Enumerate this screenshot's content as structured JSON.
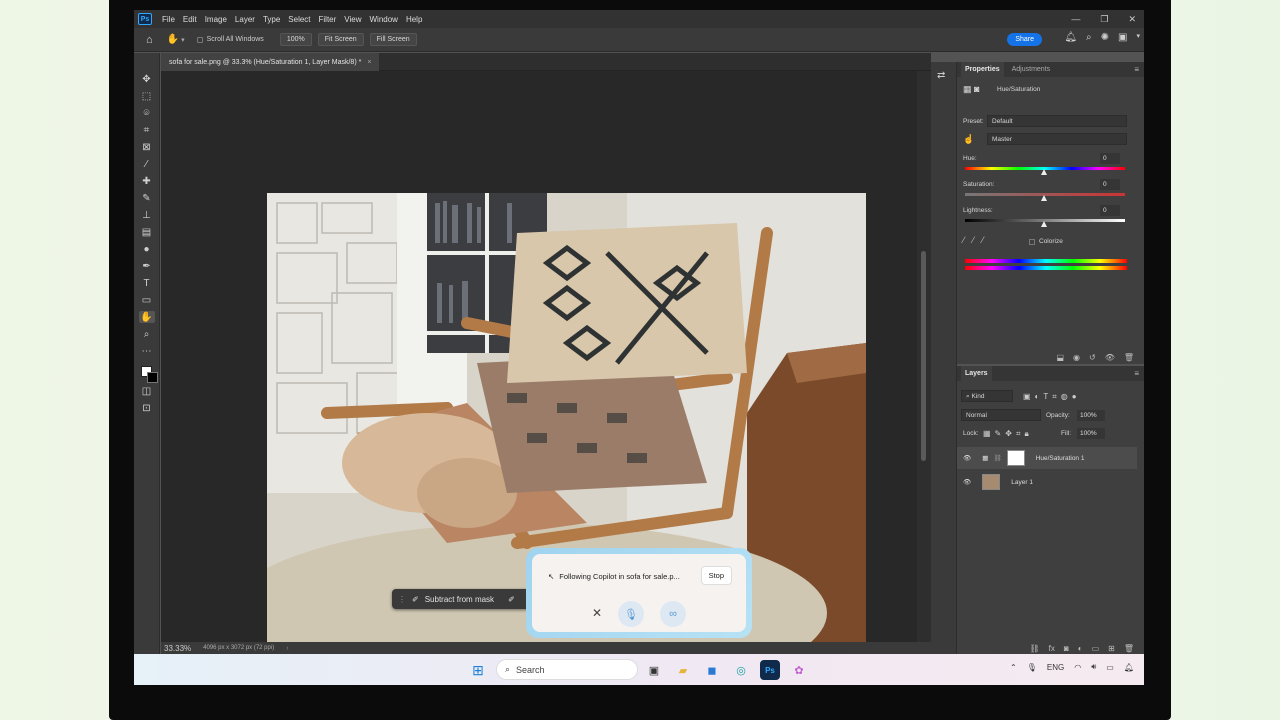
{
  "app": {
    "logo_text": "Ps",
    "menu": [
      "File",
      "Edit",
      "Image",
      "Layer",
      "Type",
      "Select",
      "Filter",
      "View",
      "Window",
      "Help"
    ]
  },
  "options_bar": {
    "scroll_all_windows": "Scroll All Windows",
    "zoom_value": "100%",
    "fit_screen": "Fit Screen",
    "fill_screen": "Fill Screen",
    "share_label": "Share"
  },
  "document": {
    "tab_title": "sofa for sale.png @ 33.3% (Hue/Saturation 1, Layer Mask/8) *",
    "zoom_status": "33.33%",
    "dimensions": "4096 px x 3072 px (72 ppi)"
  },
  "context_bar": {
    "subtract_label": "Subtract from mask"
  },
  "copilot": {
    "status_text": "Following Copilot in sofa for sale.p...",
    "stop_label": "Stop"
  },
  "properties": {
    "tabs": [
      "Properties",
      "Adjustments"
    ],
    "adjustment_name": "Hue/Saturation",
    "preset_label": "Preset:",
    "preset_value": "Default",
    "channel_value": "Master",
    "hue_label": "Hue:",
    "hue_value": "0",
    "saturation_label": "Saturation:",
    "saturation_value": "0",
    "lightness_label": "Lightness:",
    "lightness_value": "0",
    "colorize_label": "Colorize"
  },
  "layers_panel": {
    "title": "Layers",
    "kind_filter": "Kind",
    "blend_mode": "Normal",
    "opacity_label": "Opacity:",
    "opacity_value": "100%",
    "lock_label": "Lock:",
    "fill_label": "Fill:",
    "fill_value": "100%",
    "layers": [
      {
        "name": "Hue/Saturation 1",
        "selected": true
      },
      {
        "name": "Layer 1",
        "selected": false
      }
    ]
  },
  "taskbar": {
    "search_placeholder": "Search",
    "language": "ENG"
  },
  "colors": {
    "accent": "#1473e6",
    "ps_blue": "#31a8ff",
    "copilot_ring": "#9fd3ef"
  }
}
